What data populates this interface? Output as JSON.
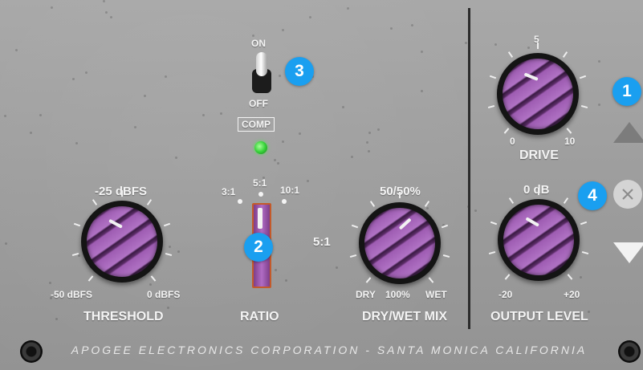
{
  "compressor": {
    "switch": {
      "on_label": "ON",
      "off_label": "OFF",
      "state": "ON"
    },
    "comp_label": "COMP",
    "led_color": "#38d43a",
    "threshold": {
      "value_label": "-25 dBFS",
      "min_label": "-50 dBFS",
      "max_label": "0 dBFS",
      "name": "THRESHOLD",
      "fraction": 0.5
    },
    "ratio": {
      "options": [
        "3:1",
        "5:1",
        "10:1"
      ],
      "selected": "5:1",
      "side_label": "5:1",
      "name": "RATIO"
    },
    "mix": {
      "value_label": "50/50%",
      "left_label": "DRY",
      "center_label": "100%",
      "right_label": "WET",
      "name": "DRY/WET MIX",
      "fraction": 0.5
    }
  },
  "drive": {
    "scale_top": "5",
    "min_label": "0",
    "max_label": "10",
    "name": "DRIVE"
  },
  "output": {
    "value_label": "0 dB",
    "min_label": "-20",
    "max_label": "+20",
    "name": "OUTPUT LEVEL"
  },
  "badges": {
    "b1": "1",
    "b2": "2",
    "b3": "3",
    "b4": "4"
  },
  "badge_color": "#1a9ff0",
  "knob_color": "#a05fb4",
  "footer": {
    "text": "APOGEE ELECTRONICS CORPORATION - SANTA MONICA CALIFORNIA"
  },
  "icons": {
    "up": "triangle-up-icon",
    "down": "triangle-down-icon",
    "close": "close-icon"
  }
}
